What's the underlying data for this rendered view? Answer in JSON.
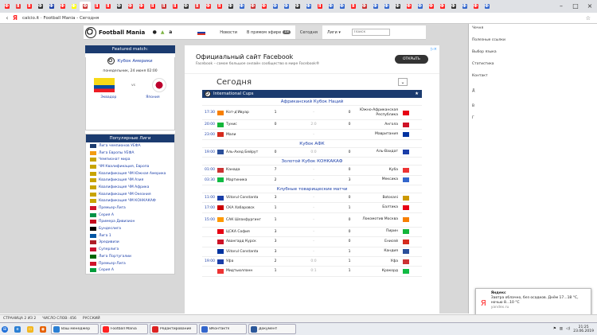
{
  "browser": {
    "tabs": [
      "Ф",
      "Я",
      "Я",
      "Ф",
      "Ф",
      "Ф",
      "Ф",
      "Ф",
      "Я",
      "Я",
      "Ф",
      "Ф",
      "Ф",
      "Я",
      "Я",
      "Я",
      "Ф",
      "Я",
      "Ф",
      "Я",
      "Ф",
      "Ф",
      "Ф",
      "Ф",
      "Ф",
      "Ф",
      "Ф",
      "Ф",
      "Я",
      "Ф",
      "Ф",
      "Я",
      "Ф",
      "Ф",
      "Ф",
      "Ф",
      "Ф",
      "Ф",
      "Ф",
      "Ф",
      "Ф",
      "Ф",
      "Ф",
      "Ф"
    ],
    "url": "calcio.it",
    "page_title": "Football Mania - Сегодня"
  },
  "site": {
    "logo_text": "Football Mania",
    "nav": [
      "Новости",
      "В прямом эфире",
      "Сегодня",
      "Лиги"
    ],
    "live_count": "18",
    "search_placeholder": "Поиск"
  },
  "featured": {
    "header": "Featured match:",
    "competition": "Кубок Америки",
    "date": "понедельник, 24 июня 02:00",
    "vs": "vs",
    "home": "Эквадор",
    "away": "Япония"
  },
  "popular": {
    "header": "Популярные Лиги",
    "leagues": [
      "Лига чемпионов УЕФА",
      "Лига Европы УЕФА",
      "Чемпионат мира",
      "ЧМ Квалификация, Европа",
      "Квалификация ЧМ Южная Америка",
      "Квалификация ЧМ Азия",
      "Квалификация ЧМ Африка",
      "Квалификация ЧМ Океания",
      "Квалификация ЧМ КОНКАКАФ",
      "Премьер-Лига",
      "Серия А",
      "Примера Дивизион",
      "Бундеслига",
      "Лига 1",
      "Эредивизи",
      "Суперлига",
      "Лига Португалии",
      "Премьер-Лига",
      "Серия А"
    ]
  },
  "ad": {
    "title": "Официальный сайт Facebook",
    "subtitle": "Facebook – самое большое онлайн сообщество в мире Facebook®",
    "button": "ОТКРЫТЬ"
  },
  "today": {
    "heading": "Сегодня",
    "cups_header": "International Cups",
    "competitions": [
      {
        "name": "Африканский Кубок Наций",
        "matches": [
          {
            "time": "17:30",
            "home": "Кот-д'Ивуар",
            "hs": "1",
            "ht": "-",
            "as": "0",
            "away": "Южно-Африканская Республика"
          },
          {
            "time": "20:00",
            "home": "Тунис",
            "hs": "0",
            "ht": "2:0",
            "as": "0",
            "away": "Ангола"
          },
          {
            "time": "23:00",
            "home": "Мали",
            "hs": "",
            "ht": "-",
            "as": "",
            "away": "Мавритания"
          }
        ]
      },
      {
        "name": "Кубок АФК",
        "matches": [
          {
            "time": "19:00",
            "home": "Аль-Ахед Бейрут",
            "hs": "0",
            "ht": "0:0",
            "as": "0",
            "away": "Аль-Вахдат"
          }
        ]
      },
      {
        "name": "Золотой Кубок КОНКАКАФ",
        "matches": [
          {
            "time": "01:00",
            "home": "Канада",
            "hs": "7",
            "ht": "-",
            "as": "0",
            "away": "Куба"
          },
          {
            "time": "03:30",
            "home": "Мартиника",
            "hs": "2",
            "ht": "-",
            "as": "3",
            "away": "Мексика"
          }
        ]
      },
      {
        "name": "Клубные товарищеские матчи",
        "matches": [
          {
            "time": "11:00",
            "home": "Viitorul Constanta",
            "hs": "3",
            "ht": "-",
            "as": "0",
            "away": "Botosani"
          },
          {
            "time": "17:00",
            "home": "СКА Хабаровск",
            "hs": "1",
            "ht": "-",
            "as": "1",
            "away": "Балтика"
          },
          {
            "time": "15:00",
            "home": "САК Шлахфургинг",
            "hs": "1",
            "ht": "-",
            "as": "0",
            "away": "Локомотив Москва"
          },
          {
            "time": "",
            "home": "ЦСКА София",
            "hs": "3",
            "ht": "-",
            "as": "0",
            "away": "Пирин"
          },
          {
            "time": "",
            "home": "Авангард Курск",
            "hs": "3",
            "ht": "-",
            "as": "0",
            "away": "Енисей"
          },
          {
            "time": "",
            "home": "Viitorul Constanta",
            "hs": "3",
            "ht": "-",
            "as": "1",
            "away": "Кандия"
          },
          {
            "time": "19:00",
            "home": "Уфа",
            "hs": "2",
            "ht": "0:0",
            "as": "1",
            "away": "Уфа"
          },
          {
            "time": "",
            "home": "Мидтьюлланн",
            "hs": "1",
            "ht": "0:1",
            "as": "1",
            "away": "Кракорд"
          }
        ]
      }
    ]
  },
  "right_pane": {
    "lines": [
      "Чечня",
      "",
      "Полезные ссылки",
      "",
      "Выбор языка",
      "",
      "Статистика",
      "",
      "Контакт",
      "",
      "",
      "Д",
      "",
      "",
      "В",
      "",
      "Г"
    ]
  },
  "notification": {
    "title": "Яндекс",
    "body": "Завтра облачно, без осадков. Днём 17...18 °C, ночью 8...10 °C",
    "source": "yandex.ru"
  },
  "status": {
    "page": "СТРАНИЦА 2 ИЗ 2",
    "words": "ЧИСЛО СЛОВ: 456",
    "lang": "РУССКИЙ"
  },
  "taskbar": {
    "items": [
      "Ваш менеджер",
      "Football Mania",
      "Редактирование",
      "ВКонтакте",
      "Документ"
    ],
    "time": "21:25",
    "date": "23.06.2019"
  }
}
